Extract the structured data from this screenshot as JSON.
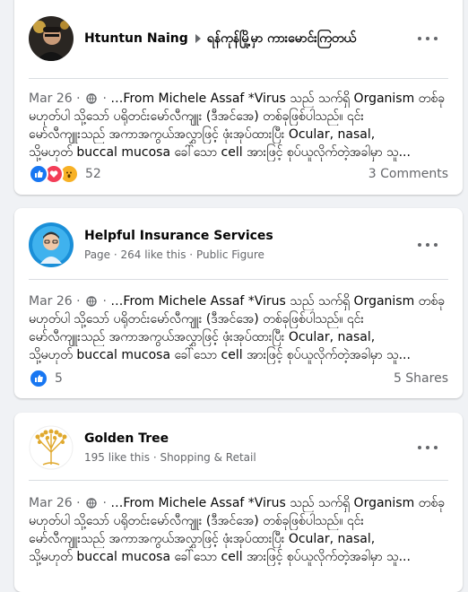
{
  "posts": [
    {
      "author": "Htuntun Naing",
      "group": "ရန်ကုန်မြို့မှာ ကားမောင်းကြတယ်",
      "date": "Mar 26",
      "sep": " · ",
      "lines": [
        "…From Michele Assaf *Virus သည် သက်ရှိ Organism တစ်ခု",
        "မဟုတ်ပါ သို့သော် ပရိုတင်းမော်လီကျူး (ဒီအင်အေ) တစ်ခုဖြစ်ပါသည်။ ၎င်း",
        "မော်လီကျူးသည် အကာအကွယ်အလွှာဖြင့် ဖုံးအုပ်ထားပြီး Ocular, nasal,",
        "သို့မဟုတ် buccal mucosa ခေါ်သော cell အားဖြင့် စုပ်ယူလိုက်တဲ့အခါမှာ သူ..."
      ],
      "reaction_count": "52",
      "right_stat": "3 Comments"
    },
    {
      "author": "Helpful Insurance Services",
      "subtitle": "Page · 264 like this · Public Figure",
      "date": "Mar 26",
      "sep": " · ",
      "lines": [
        "…From Michele Assaf *Virus သည် သက်ရှိ Organism တစ်ခု",
        "မဟုတ်ပါ သို့သော် ပရိုတင်းမော်လီကျူး (ဒီအင်အေ) တစ်ခုဖြစ်ပါသည်။ ၎င်း",
        "မော်လီကျူးသည် အကာအကွယ်အလွှာဖြင့် ဖုံးအုပ်ထားပြီး Ocular, nasal,",
        "သို့မဟုတ် buccal mucosa ခေါ်သော cell အားဖြင့် စုပ်ယူလိုက်တဲ့အခါမှာ သူ..."
      ],
      "reaction_count": "5",
      "right_stat": "5 Shares"
    },
    {
      "author": "Golden Tree",
      "subtitle": "195 like this · Shopping & Retail",
      "date": "Mar 26",
      "sep": " · ",
      "lines": [
        "…From Michele Assaf *Virus သည် သက်ရှိ Organism တစ်ခု",
        "မဟုတ်ပါ သို့သော် ပရိုတင်းမော်လီကျူး (ဒီအင်အေ) တစ်ခုဖြစ်ပါသည်။ ၎င်း",
        "မော်လီကျူးသည် အကာအကွယ်အလွှာဖြင့် ဖုံးအုပ်ထားပြီး Ocular, nasal,",
        "သို့မဟုတ် buccal mucosa ခေါ်သော cell အားဖြင့် စုပ်ယူလိုက်တဲ့အခါမှာ သူ..."
      ]
    }
  ],
  "colors": {
    "accent": "#1877f2",
    "muted": "#65676b",
    "background": "#f0f2f5",
    "gold": "#e0a92e"
  },
  "icons": [
    "avatar-photo",
    "insurance-avatar",
    "golden-tree-logo",
    "globe-icon",
    "more-options-icon",
    "like-reaction-icon",
    "love-reaction-icon",
    "wow-reaction-icon",
    "caret-right-icon"
  ]
}
